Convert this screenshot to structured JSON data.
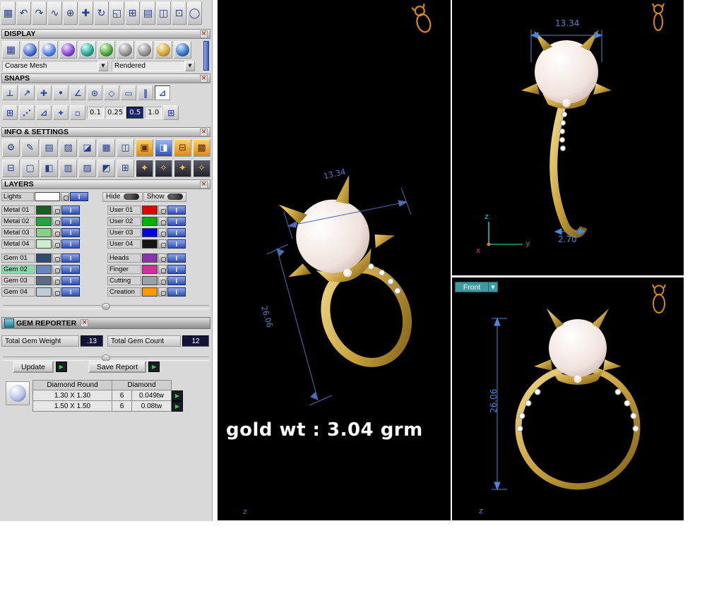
{
  "display": {
    "title": "DISPLAY",
    "mesh_mode": "Coarse Mesh",
    "render_mode": "Rendered"
  },
  "snaps": {
    "title": "SNAPS",
    "values": [
      "0.1",
      "0.25",
      "0.5",
      "1.0"
    ],
    "selected": "0.5"
  },
  "info": {
    "title": "INFO & SETTINGS"
  },
  "layers": {
    "title": "LAYERS",
    "lights_label": "Lights",
    "lights_color": "#ffffff",
    "hide_label": "Hide",
    "show_label": "Show",
    "i_label": "I",
    "left": [
      {
        "label": "Metal 01",
        "color": "#1d5c20"
      },
      {
        "label": "Metal 02",
        "color": "#2f9e3f"
      },
      {
        "label": "Metal 03",
        "color": "#7ed77e"
      },
      {
        "label": "Metal 04",
        "color": "#c9eec9"
      },
      {
        "label": "Gem 01",
        "color": "#2e4b6e"
      },
      {
        "label": "Gem 02",
        "color": "#6688bb"
      },
      {
        "label": "Gem 03",
        "color": "#5a6c85"
      },
      {
        "label": "Gem 04",
        "color": "#c0cbd8"
      }
    ],
    "right": [
      {
        "label": "User 01",
        "color": "#e00000"
      },
      {
        "label": "User 02",
        "color": "#00b000"
      },
      {
        "label": "User 03",
        "color": "#0000e0"
      },
      {
        "label": "User 04",
        "color": "#151515"
      },
      {
        "label": "Heads",
        "color": "#8833aa"
      },
      {
        "label": "Finger",
        "color": "#cc3399"
      },
      {
        "label": "Cutting",
        "color": "#9aa0a8"
      },
      {
        "label": "Creation",
        "color": "#ff9900"
      }
    ]
  },
  "gem_reporter": {
    "title": "GEM REPORTER",
    "weight_label": "Total Gem Weight",
    "weight_value": ".13",
    "count_label": "Total Gem Count",
    "count_value": "12",
    "update_label": "Update",
    "save_label": "Save Report",
    "table": {
      "col_shape": "Diamond Round",
      "col_type": "Diamond",
      "rows": [
        {
          "size": "1.30 X 1.30",
          "count": "6",
          "weight": "0.049tw"
        },
        {
          "size": "1.50 X 1.50",
          "count": "6",
          "weight": "0.08tw"
        }
      ]
    }
  },
  "viewports": {
    "main": {
      "dim_width": "13.34",
      "dim_height": "26.06",
      "weight_text": "gold wt : 3.04 grm",
      "axis_z": "z"
    },
    "side": {
      "dim_width": "13.34",
      "dim_thickness": "2.70",
      "axis_x": "x",
      "axis_y": "y",
      "axis_z": "z"
    },
    "front": {
      "view_label": "Front",
      "dim_height": "26.06",
      "axis_z": "z"
    }
  },
  "colors": {
    "accent_blue": "#3050b0",
    "dim_line": "#4a6fb5",
    "gold": "#c8a23c",
    "viewport_bg": "#000000",
    "front_drop": "#3d9aa0"
  },
  "icons": {
    "close": "×",
    "dropdown_arrow": "▼",
    "play": "▶",
    "collapse": "o",
    "top": [
      "▦",
      "↶",
      "↷",
      "∿",
      "⊕",
      "✚",
      "↻",
      "◱",
      "⊞",
      "▤",
      "◫",
      "⊡",
      "◯"
    ],
    "display_grid": "▦",
    "snaps1": [
      "⊥",
      "↗",
      "✚",
      "•",
      "∠",
      "⊙",
      "◇",
      "▭",
      "‖",
      "⊿"
    ],
    "snaps2_lead": [
      "⊞",
      "⋰",
      "⊿",
      "✦",
      "▫"
    ],
    "snaps2_tail": "⊞",
    "info1": [
      "⚙",
      "✎",
      "▤",
      "▨",
      "◪",
      "▦",
      "◫"
    ],
    "info1_tiles": [
      "▣",
      "◨",
      "⊟",
      "▩"
    ],
    "info2": [
      "⊟",
      "▢",
      "◧",
      "▥",
      "▨",
      "◩",
      "⊞"
    ],
    "info2_tiles": [
      "✦",
      "✧",
      "✦",
      "✧"
    ]
  }
}
